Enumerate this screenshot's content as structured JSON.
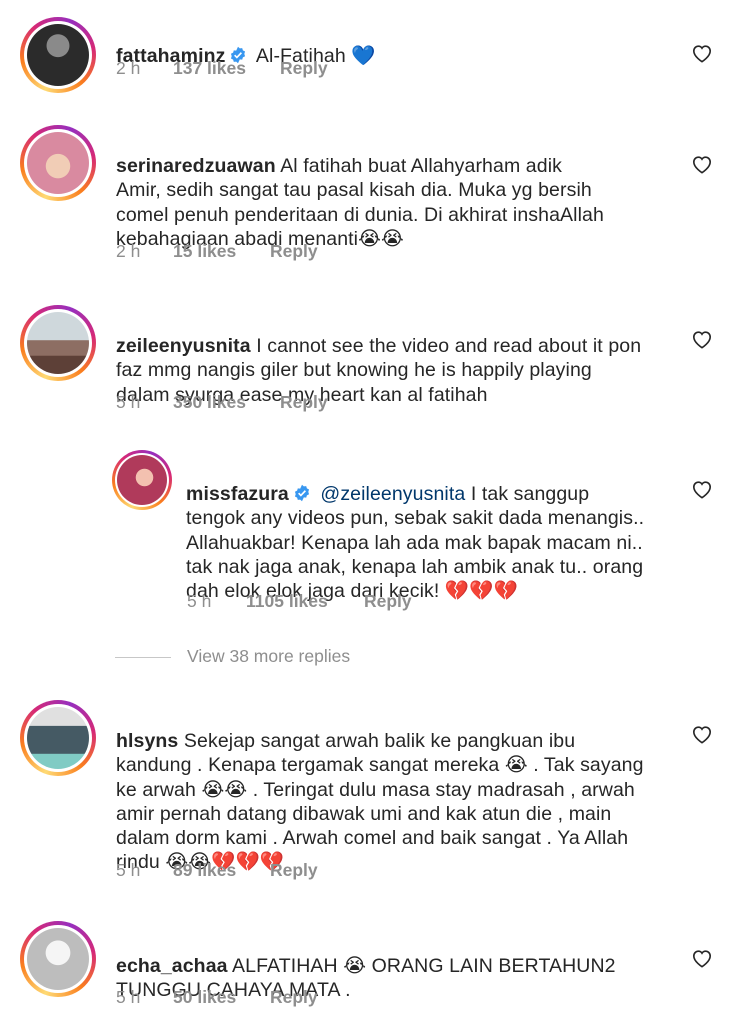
{
  "comments": [
    {
      "username": "fattahaminz",
      "verified": true,
      "text": "Al-Fatihah 💙",
      "time": "2 h",
      "likes": "137 likes",
      "reply": "Reply"
    },
    {
      "username": "serinaredzuawan",
      "verified": false,
      "text": "Al fatihah buat Allahyarham adik\nAmir, sedih sangat tau pasal kisah dia. Muka yg bersih\ncomel penuh penderitaan di dunia. Di akhirat inshaAllah\nkebahagiaan abadi menanti😭😭",
      "time": "2 h",
      "likes": "15 likes",
      "reply": "Reply"
    },
    {
      "username": "zeileenyusnita",
      "verified": false,
      "text": "I cannot see the video and read about it pon\nfaz mmg nangis giler but knowing he is happily playing\ndalam syurga ease my heart kan  al fatihah",
      "time": "5 h",
      "likes": "350 likes",
      "reply": "Reply"
    },
    {
      "username": "missfazura",
      "verified": true,
      "mention": "@zeileenyusnita",
      "text": " I tak sanggup\ntengok any videos pun, sebak sakit dada menangis..\nAllahuakbar! Kenapa lah ada mak bapak macam ni..\ntak nak jaga anak, kenapa lah ambik anak tu.. orang\ndah elok elok jaga dari kecik! 💔💔💔",
      "time": "5 h",
      "likes": "1105 likes",
      "reply": "Reply"
    },
    {
      "username": "hlsyns",
      "verified": false,
      "text": "Sekejap sangat arwah balik ke pangkuan ibu\nkandung . Kenapa tergamak sangat mereka 😭 . Tak sayang\nke arwah 😭😭 . Teringat dulu masa stay madrasah , arwah\namir pernah datang dibawak umi and kak atun die , main\ndalam dorm kami . Arwah comel and baik sangat . Ya Allah\nrindu 😭😭💔💔💔",
      "time": "5 h",
      "likes": "89 likes",
      "reply": "Reply"
    },
    {
      "username": "echa_achaa",
      "verified": false,
      "text": "ALFATIHAH 😭 ORANG LAIN BERTAHUN2\nTUNGGU CAHAYA MATA .",
      "time": "5 h",
      "likes": "50 likes",
      "reply": "Reply"
    }
  ],
  "view_more_replies": "View 38 more replies",
  "colors": {
    "text": "#262626",
    "meta": "#8e8e8e",
    "verified": "#3897f0",
    "mention": "#00376b"
  },
  "icons": {
    "like": "heart-outline-icon",
    "verified": "verified-badge-icon"
  }
}
